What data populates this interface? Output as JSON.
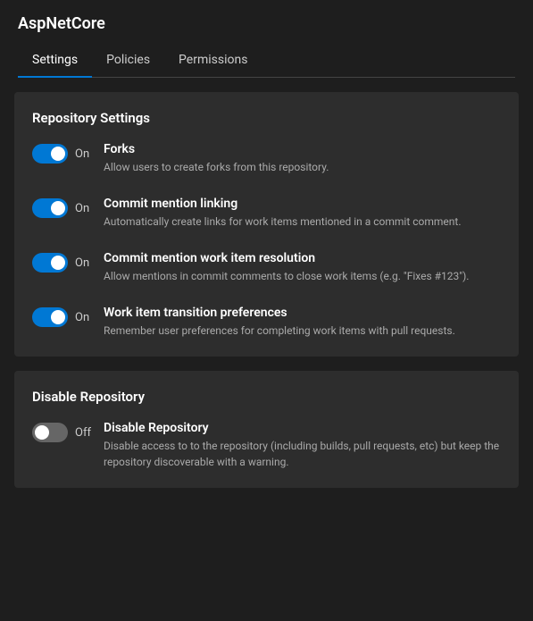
{
  "app": {
    "title": "AspNetCore"
  },
  "tabs": [
    {
      "label": "Settings",
      "active": true
    },
    {
      "label": "Policies",
      "active": false
    },
    {
      "label": "Permissions",
      "active": false
    }
  ],
  "sections": [
    {
      "title": "Repository Settings",
      "settings": [
        {
          "id": "forks",
          "state": "on",
          "state_label": "On",
          "name": "Forks",
          "description": "Allow users to create forks from this repository."
        },
        {
          "id": "commit-mention-linking",
          "state": "on",
          "state_label": "On",
          "name": "Commit mention linking",
          "description": "Automatically create links for work items mentioned in a commit comment."
        },
        {
          "id": "commit-mention-resolution",
          "state": "on",
          "state_label": "On",
          "name": "Commit mention work item resolution",
          "description": "Allow mentions in commit comments to close work items (e.g. \"Fixes #123\")."
        },
        {
          "id": "work-item-transition",
          "state": "on",
          "state_label": "On",
          "name": "Work item transition preferences",
          "description": "Remember user preferences for completing work items with pull requests."
        }
      ]
    },
    {
      "title": "Disable Repository",
      "settings": [
        {
          "id": "disable-repository",
          "state": "off",
          "state_label": "Off",
          "name": "Disable Repository",
          "description": "Disable access to to the repository (including builds, pull requests, etc) but keep the repository discoverable with a warning."
        }
      ]
    }
  ]
}
